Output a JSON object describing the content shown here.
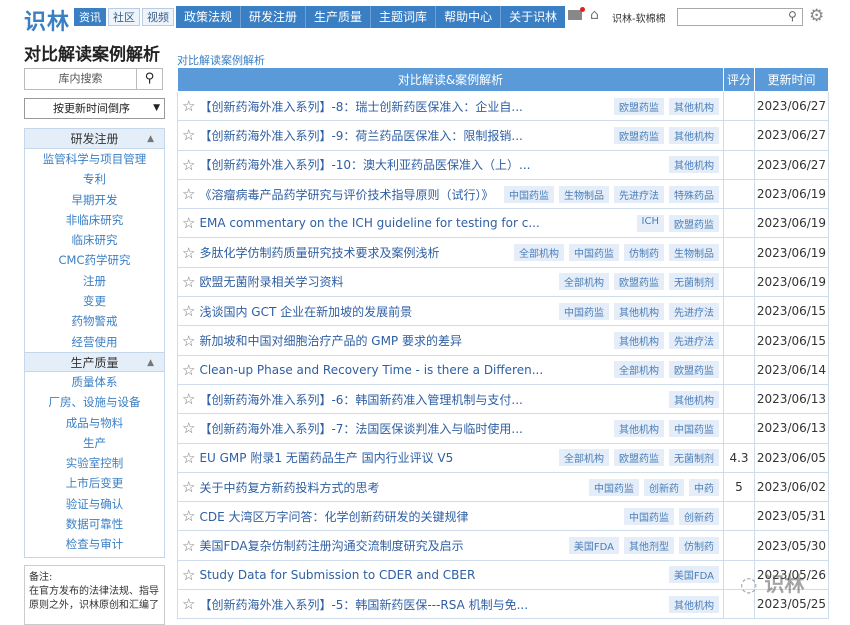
{
  "brand": {
    "logo": "识林",
    "user": "识林-软棉棉"
  },
  "subtabs": [
    "资讯",
    "社区",
    "视频"
  ],
  "nav": [
    "政策法规",
    "研发注册",
    "生产质量",
    "主题词库",
    "帮助中心",
    "关于识林"
  ],
  "icons": {
    "mail": "mail-icon",
    "home": "home-icon",
    "search": "search-icon",
    "settings": "gear-icon"
  },
  "page_title": "对比解读案例解析",
  "side_search_placeholder": "库内搜索",
  "sort_value": "按更新时间倒序",
  "sidebar": {
    "group1": "研发注册",
    "group1_items": [
      "监管科学与项目管理",
      "专利",
      "早期开发",
      "非临床研究",
      "临床研究",
      "CMC药学研究",
      "注册",
      "变更",
      "药物警戒",
      "经营使用"
    ],
    "group2": "生产质量",
    "group2_items": [
      "质量体系",
      "厂房、设施与设备",
      "成品与物料",
      "生产",
      "实验室控制",
      "上市后变更",
      "验证与确认",
      "数据可靠性",
      "检查与审计"
    ]
  },
  "note": {
    "label": "备注:",
    "text": "在官方发布的法律法规、指导原则之外，识林原创和汇编了"
  },
  "breadcrumb": "对比解读案例解析",
  "table": {
    "headers": [
      "对比解读&案例解析",
      "评分",
      "更新时间"
    ],
    "rows": [
      {
        "title": "【创新药海外准入系列】-8：瑞士创新药医保准入：企业自...",
        "tags": [
          "欧盟药监",
          "其他机构"
        ],
        "score": "",
        "date": "2023/06/27"
      },
      {
        "title": "【创新药海外准入系列】-9：荷兰药品医保准入：限制报销...",
        "tags": [
          "欧盟药监",
          "其他机构"
        ],
        "score": "",
        "date": "2023/06/27"
      },
      {
        "title": "【创新药海外准入系列】-10：澳大利亚药品医保准入（上）...",
        "tags": [
          "其他机构"
        ],
        "score": "",
        "date": "2023/06/27"
      },
      {
        "title": "《溶瘤病毒产品药学研究与评价技术指导原则（试行）》解读",
        "tags": [
          "中国药监",
          "生物制品",
          "先进疗法",
          "特殊药品"
        ],
        "score": "",
        "date": "2023/06/19"
      },
      {
        "title": "EMA commentary on the ICH guideline for testing for c...",
        "tags": [
          "ICH",
          "欧盟药监"
        ],
        "score": "",
        "date": "2023/06/19"
      },
      {
        "title": "多肽化学仿制药质量研究技术要求及案例浅析",
        "tags": [
          "全部机构",
          "中国药监",
          "仿制药",
          "生物制品"
        ],
        "score": "",
        "date": "2023/06/19"
      },
      {
        "title": "欧盟无菌附录相关学习资料",
        "tags": [
          "全部机构",
          "欧盟药监",
          "无菌制剂"
        ],
        "score": "",
        "date": "2023/06/19"
      },
      {
        "title": "浅谈国内 GCT 企业在新加坡的发展前景",
        "tags": [
          "中国药监",
          "其他机构",
          "先进疗法"
        ],
        "score": "",
        "date": "2023/06/15"
      },
      {
        "title": "新加坡和中国对细胞治疗产品的 GMP 要求的差异",
        "tags": [
          "其他机构",
          "先进疗法"
        ],
        "score": "",
        "date": "2023/06/15"
      },
      {
        "title": "Clean-up Phase and Recovery Time - is there a Differen...",
        "tags": [
          "全部机构",
          "欧盟药监"
        ],
        "score": "",
        "date": "2023/06/14"
      },
      {
        "title": "【创新药海外准入系列】-6：韩国新药准入管理机制与支付...",
        "tags": [
          "其他机构"
        ],
        "score": "",
        "date": "2023/06/13"
      },
      {
        "title": "【创新药海外准入系列】-7：法国医保谈判准入与临时使用...",
        "tags": [
          "其他机构",
          "中国药监"
        ],
        "score": "",
        "date": "2023/06/13"
      },
      {
        "title": "EU GMP 附录1 无菌药品生产 国内行业评议 V5",
        "tags": [
          "全部机构",
          "欧盟药监",
          "无菌制剂"
        ],
        "score": "4.3",
        "date": "2023/06/05"
      },
      {
        "title": "关于中药复方新药投料方式的思考",
        "tags": [
          "中国药监",
          "创新药",
          "中药"
        ],
        "score": "5",
        "date": "2023/06/02"
      },
      {
        "title": "CDE 大湾区万字问答：化学创新药研发的关键规律",
        "tags": [
          "中国药监",
          "创新药"
        ],
        "score": "",
        "date": "2023/05/31"
      },
      {
        "title": "美国FDA复杂仿制药注册沟通交流制度研究及启示",
        "tags": [
          "美国FDA",
          "其他剂型",
          "仿制药"
        ],
        "score": "",
        "date": "2023/05/30"
      },
      {
        "title": "Study Data for Submission to CDER and CBER",
        "tags": [
          "美国FDA"
        ],
        "score": "",
        "date": "2023/05/26"
      },
      {
        "title": "【创新药海外准入系列】-5：韩国新药医保---RSA 机制与免...",
        "tags": [
          "其他机构"
        ],
        "score": "",
        "date": "2023/05/25"
      }
    ]
  },
  "watermark": "识林"
}
